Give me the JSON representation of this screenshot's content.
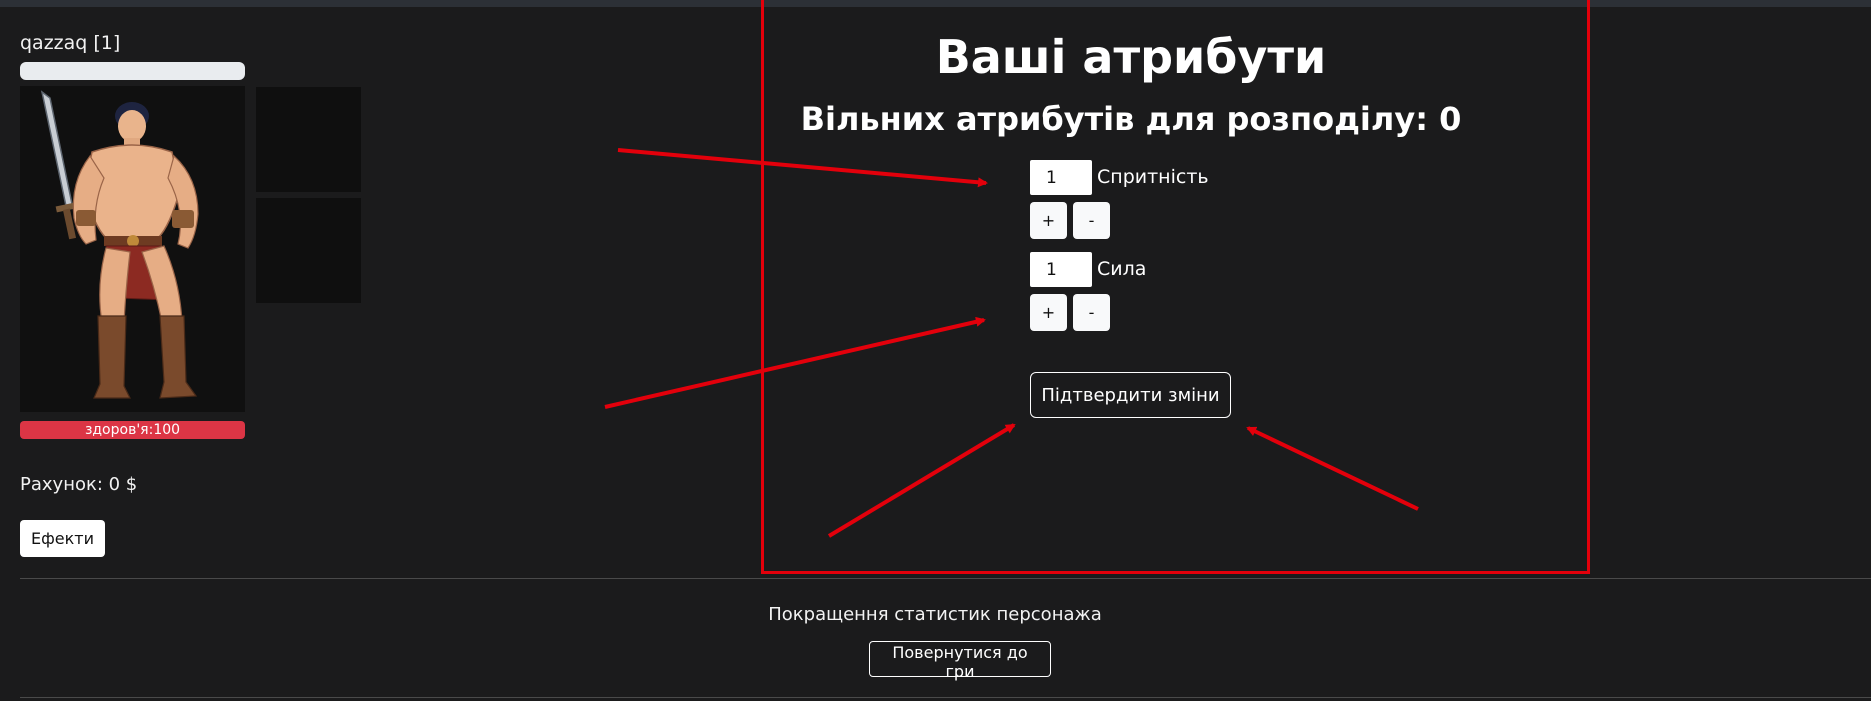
{
  "character": {
    "name": "qazzaq [1]",
    "health_text": "здоров'я:100",
    "account_text": "Рахунок: 0 $",
    "effects_label": "Ефекти"
  },
  "attributes": {
    "title": "Ваші атрибути",
    "free_text": "Вільних атрибутів для розподілу: 0",
    "items": [
      {
        "label": "Спритність",
        "value": "1"
      },
      {
        "label": "Сила",
        "value": "1"
      }
    ],
    "plus_label": "+",
    "minus_label": "-",
    "confirm_label": "Підтвердити зміни"
  },
  "footer": {
    "title": "Покращення статистик персонажа",
    "return_label": "Повернутися до гри"
  },
  "colors": {
    "background": "#1b1b1c",
    "health": "#dc3545",
    "annotation": "#e3000b"
  }
}
